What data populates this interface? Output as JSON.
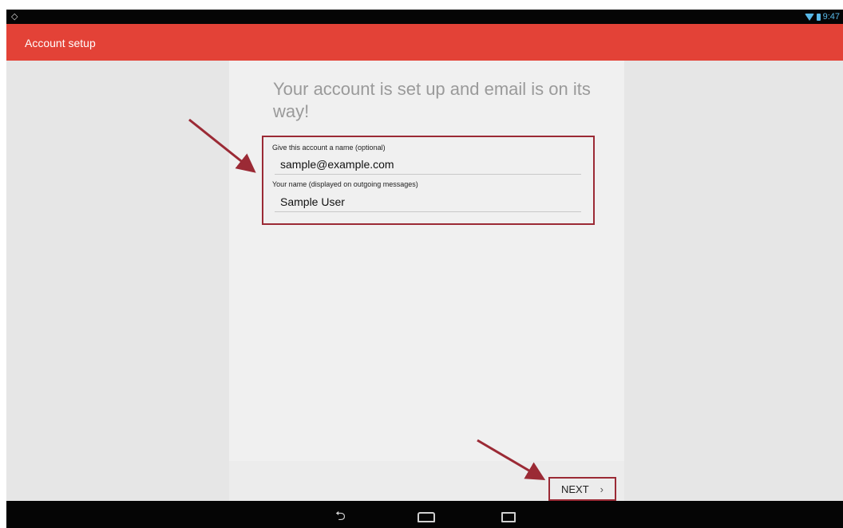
{
  "statusbar": {
    "time": "9:47"
  },
  "appbar": {
    "title": "Account setup"
  },
  "main": {
    "headline": "Your account is set up and email is on its way!",
    "account_name_label": "Give this account a name (optional)",
    "account_name_value": "sample@example.com",
    "your_name_label": "Your name (displayed on outgoing messages)",
    "your_name_value": "Sample User",
    "next_label": "NEXT"
  },
  "colors": {
    "appbar": "#e34237",
    "annotation": "#9b2a35",
    "status_accent": "#58b9e8"
  },
  "icons": {
    "status_left": "android-location-icon",
    "wifi": "wifi-icon",
    "battery": "battery-icon",
    "next": "chevron-right-icon",
    "nav_back": "back-icon",
    "nav_home": "home-icon",
    "nav_recent": "recent-apps-icon"
  }
}
